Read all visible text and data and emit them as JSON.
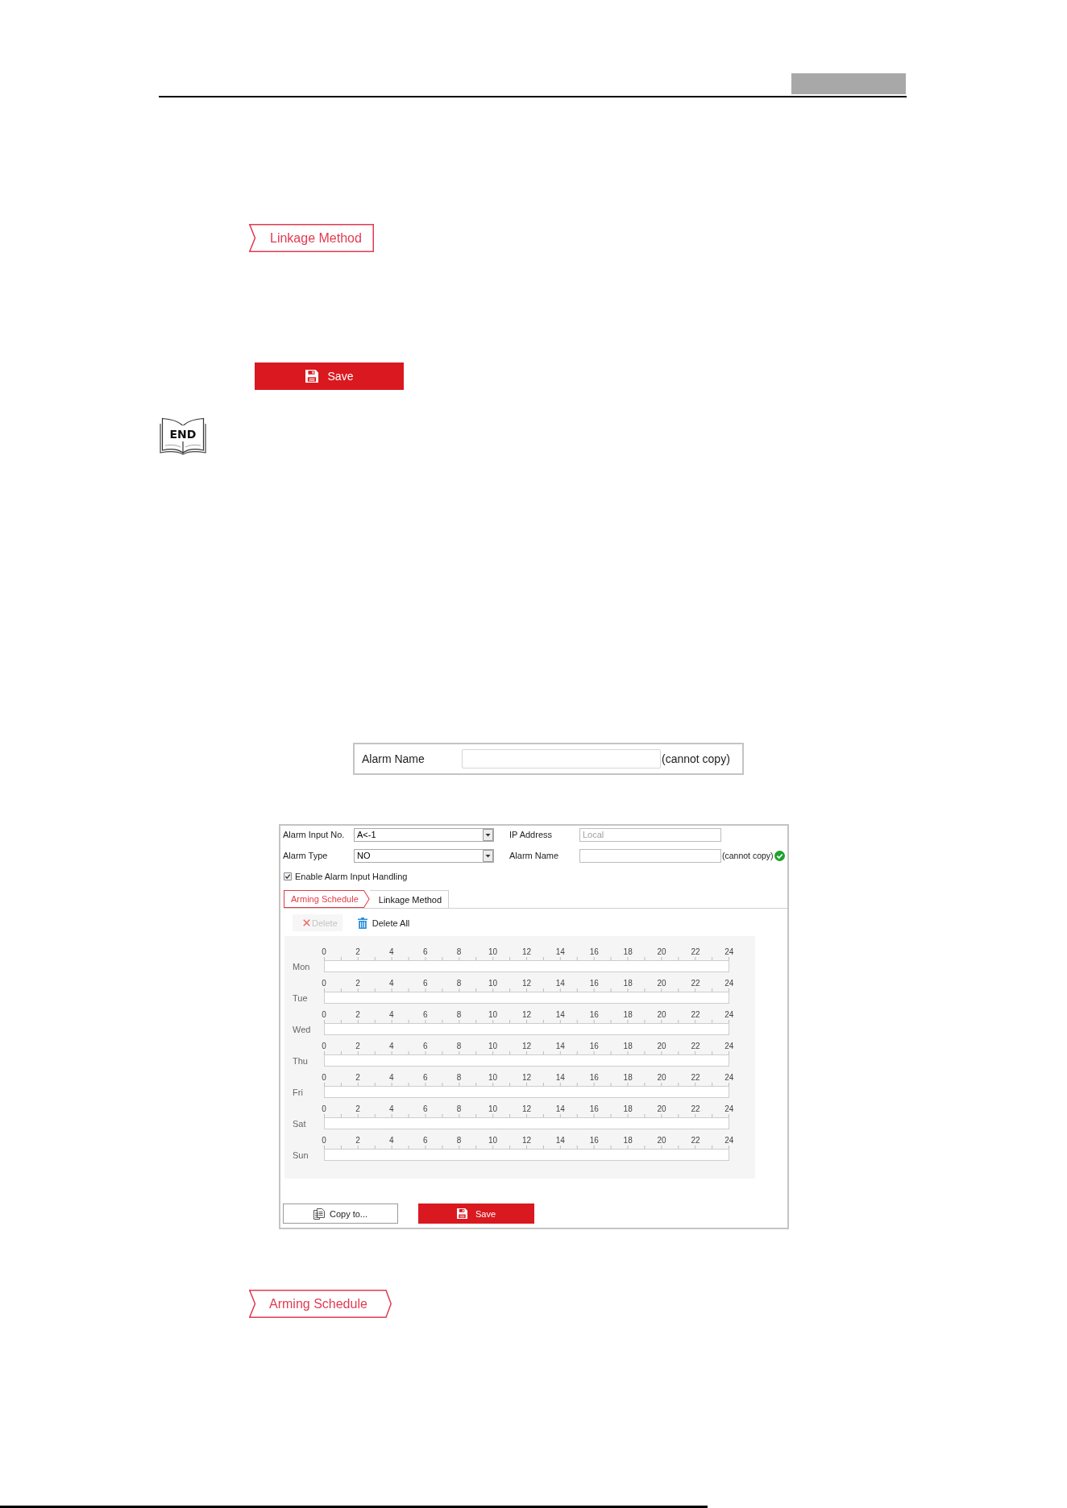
{
  "linkage_method_tab": {
    "label": "Linkage Method"
  },
  "save_button": {
    "label": "Save"
  },
  "end_mark": {
    "label": "END"
  },
  "alarm_name_field": {
    "label": "Alarm Name",
    "note": "(cannot copy)"
  },
  "alarm_input_panel": {
    "fields": [
      {
        "label": "Alarm Input No.",
        "kind": "select",
        "value": "A<-1",
        "disabled": false,
        "valid": false
      },
      {
        "label": "IP Address",
        "kind": "text",
        "value": "Local",
        "disabled": true,
        "valid": false
      },
      {
        "label": "Alarm Type",
        "kind": "select",
        "value": "NO",
        "disabled": false,
        "valid": false
      },
      {
        "label": "Alarm Name",
        "kind": "text",
        "note": "(cannot copy)",
        "disabled": false,
        "valid": true
      }
    ],
    "enable_handling": {
      "label": "Enable Alarm Input Handling",
      "checked": true
    },
    "tabs": [
      {
        "label": "Arming Schedule",
        "selected": true
      },
      {
        "label": "Linkage Method",
        "selected": false
      }
    ],
    "toolbar": [
      {
        "label": "Delete",
        "kind": "delete",
        "disabled": true
      },
      {
        "label": "Delete All",
        "kind": "delete_all",
        "disabled": false
      }
    ],
    "schedule": [
      {
        "day": "Mon",
        "ticks": [
          "0",
          "2",
          "4",
          "6",
          "8",
          "10",
          "12",
          "14",
          "16",
          "18",
          "20",
          "22",
          "24"
        ]
      },
      {
        "day": "Tue",
        "ticks": [
          "0",
          "2",
          "4",
          "6",
          "8",
          "10",
          "12",
          "14",
          "16",
          "18",
          "20",
          "22",
          "24"
        ]
      },
      {
        "day": "Wed",
        "ticks": [
          "0",
          "2",
          "4",
          "6",
          "8",
          "10",
          "12",
          "14",
          "16",
          "18",
          "20",
          "22",
          "24"
        ]
      },
      {
        "day": "Thu",
        "ticks": [
          "0",
          "2",
          "4",
          "6",
          "8",
          "10",
          "12",
          "14",
          "16",
          "18",
          "20",
          "22",
          "24"
        ]
      },
      {
        "day": "Fri",
        "ticks": [
          "0",
          "2",
          "4",
          "6",
          "8",
          "10",
          "12",
          "14",
          "16",
          "18",
          "20",
          "22",
          "24"
        ]
      },
      {
        "day": "Sat",
        "ticks": [
          "0",
          "2",
          "4",
          "6",
          "8",
          "10",
          "12",
          "14",
          "16",
          "18",
          "20",
          "22",
          "24"
        ]
      },
      {
        "day": "Sun",
        "ticks": [
          "0",
          "2",
          "4",
          "6",
          "8",
          "10",
          "12",
          "14",
          "16",
          "18",
          "20",
          "22",
          "24"
        ]
      }
    ],
    "buttons": [
      {
        "label": "Copy to...",
        "kind": "copy"
      },
      {
        "label": "Save",
        "kind": "save"
      }
    ]
  },
  "arming_schedule_tab": {
    "label": "Arming Schedule"
  }
}
